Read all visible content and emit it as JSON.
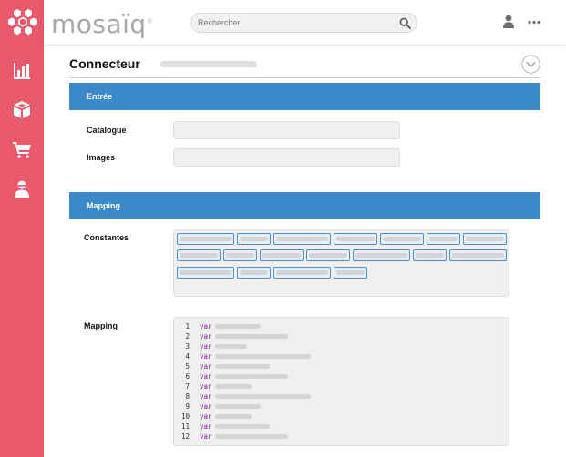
{
  "app": {
    "brand": "mosaïq",
    "brand_mark": "®",
    "logo_icon": "hexagon-cluster-icon"
  },
  "sidebar": {
    "items": [
      {
        "icon": "bar-chart-icon"
      },
      {
        "icon": "open-box-icon"
      },
      {
        "icon": "shopping-cart-icon"
      },
      {
        "icon": "agent-person-icon"
      }
    ]
  },
  "header": {
    "search": {
      "placeholder": "Rechercher",
      "value": ""
    },
    "icons": [
      "search-icon",
      "user-icon",
      "more-icon"
    ]
  },
  "page": {
    "title": "Connecteur",
    "collapse_icon": "chevron-down-circle-icon"
  },
  "sections": {
    "input": {
      "header": "Entrée",
      "fields": [
        {
          "label": "Catalogue",
          "value": ""
        },
        {
          "label": "Images",
          "value": ""
        }
      ]
    },
    "mapping": {
      "header": "Mapping",
      "constants_label": "Constantes",
      "mapping_label": "Mapping",
      "code_lines": [
        {
          "n": "1",
          "kw": "var"
        },
        {
          "n": "2",
          "kw": "var"
        },
        {
          "n": "3",
          "kw": "var"
        },
        {
          "n": "4",
          "kw": "var"
        },
        {
          "n": "5",
          "kw": "var"
        },
        {
          "n": "6",
          "kw": "var"
        },
        {
          "n": "7",
          "kw": "var"
        },
        {
          "n": "8",
          "kw": "var"
        },
        {
          "n": "9",
          "kw": "var"
        },
        {
          "n": "10",
          "kw": "var"
        },
        {
          "n": "11",
          "kw": "var"
        },
        {
          "n": "12",
          "kw": "var"
        }
      ]
    }
  },
  "colors": {
    "sidebar": "#e8596b",
    "section_header": "#3c89c9",
    "keyword": "#7a1a8c",
    "chip_border": "#4a8fd0"
  }
}
